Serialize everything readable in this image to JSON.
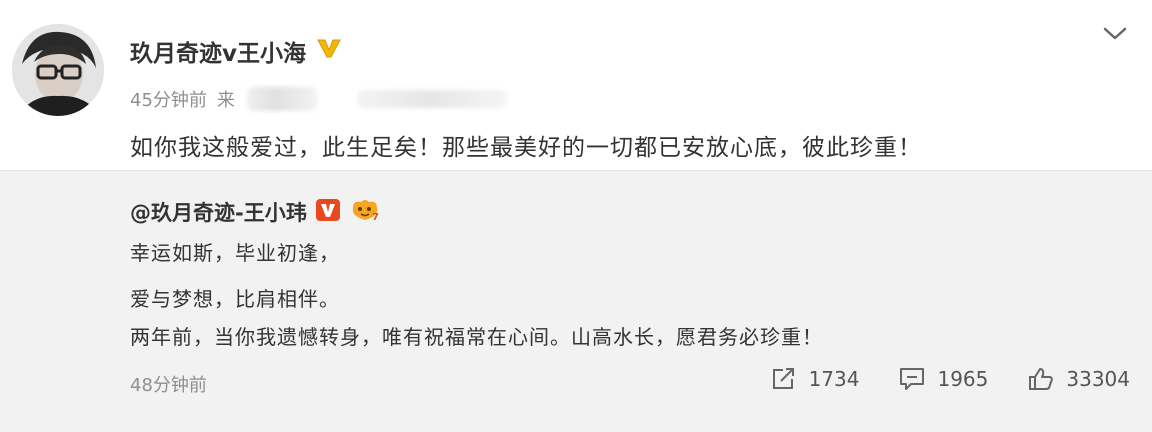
{
  "post": {
    "author": "玖月奇迹v王小海",
    "time": "45分钟前",
    "source_prefix": "来",
    "text": "如你我这般爱过，此生足矣！那些最美好的一切都已安放心底，彼此珍重！"
  },
  "repost": {
    "author": "@玖月奇迹-王小玮",
    "lines": [
      "幸运如斯，毕业初逢，",
      "爱与梦想，比肩相伴。",
      "两年前，当你我遗憾转身，唯有祝福常在心间。山高水长，愿君务必珍重！"
    ],
    "time": "48分钟前",
    "stats": {
      "reposts": "1734",
      "comments": "1965",
      "likes": "33304"
    }
  },
  "colors": {
    "verified_badge": "#f2b705",
    "vip_badge": "#e8491d",
    "repost_bg": "#f2f2f2",
    "meta_text": "#8f8f8f"
  },
  "icons": {
    "expand": "chevron-down-icon",
    "repost": "repost-icon",
    "comment": "comment-icon",
    "like": "thumbs-up-icon"
  }
}
